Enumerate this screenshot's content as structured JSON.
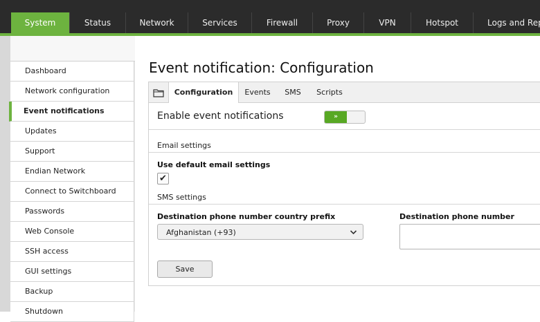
{
  "topnav": {
    "tabs": [
      {
        "label": "System",
        "active": true
      },
      {
        "label": "Status"
      },
      {
        "label": "Network"
      },
      {
        "label": "Services"
      },
      {
        "label": "Firewall"
      },
      {
        "label": "Proxy"
      },
      {
        "label": "VPN"
      },
      {
        "label": "Hotspot"
      },
      {
        "label": "Logs and Rep"
      }
    ],
    "accent_color": "#6db33f"
  },
  "sidebar": {
    "items": [
      {
        "label": "Dashboard"
      },
      {
        "label": "Network configuration"
      },
      {
        "label": "Event notifications",
        "active": true
      },
      {
        "label": "Updates"
      },
      {
        "label": "Support"
      },
      {
        "label": "Endian Network"
      },
      {
        "label": "Connect to Switchboard"
      },
      {
        "label": "Passwords"
      },
      {
        "label": "Web Console"
      },
      {
        "label": "SSH access"
      },
      {
        "label": "GUI settings"
      },
      {
        "label": "Backup"
      },
      {
        "label": "Shutdown"
      }
    ]
  },
  "main": {
    "title": "Event notification: Configuration",
    "tabs": [
      {
        "label": "Configuration",
        "active": true
      },
      {
        "label": "Events"
      },
      {
        "label": "SMS"
      },
      {
        "label": "Scripts"
      }
    ],
    "enable": {
      "label": "Enable event notifications",
      "toggle_text": "»",
      "enabled": true
    },
    "email": {
      "section_label": "Email settings",
      "use_default_label": "Use default email settings",
      "use_default_checked": true,
      "check_mark": "✔"
    },
    "sms": {
      "section_label": "SMS settings",
      "prefix_label": "Destination phone number country prefix",
      "prefix_value": "Afghanistan (+93)",
      "phone_label": "Destination phone number",
      "phone_value": ""
    },
    "save_label": "Save",
    "chevron": "⌄"
  }
}
